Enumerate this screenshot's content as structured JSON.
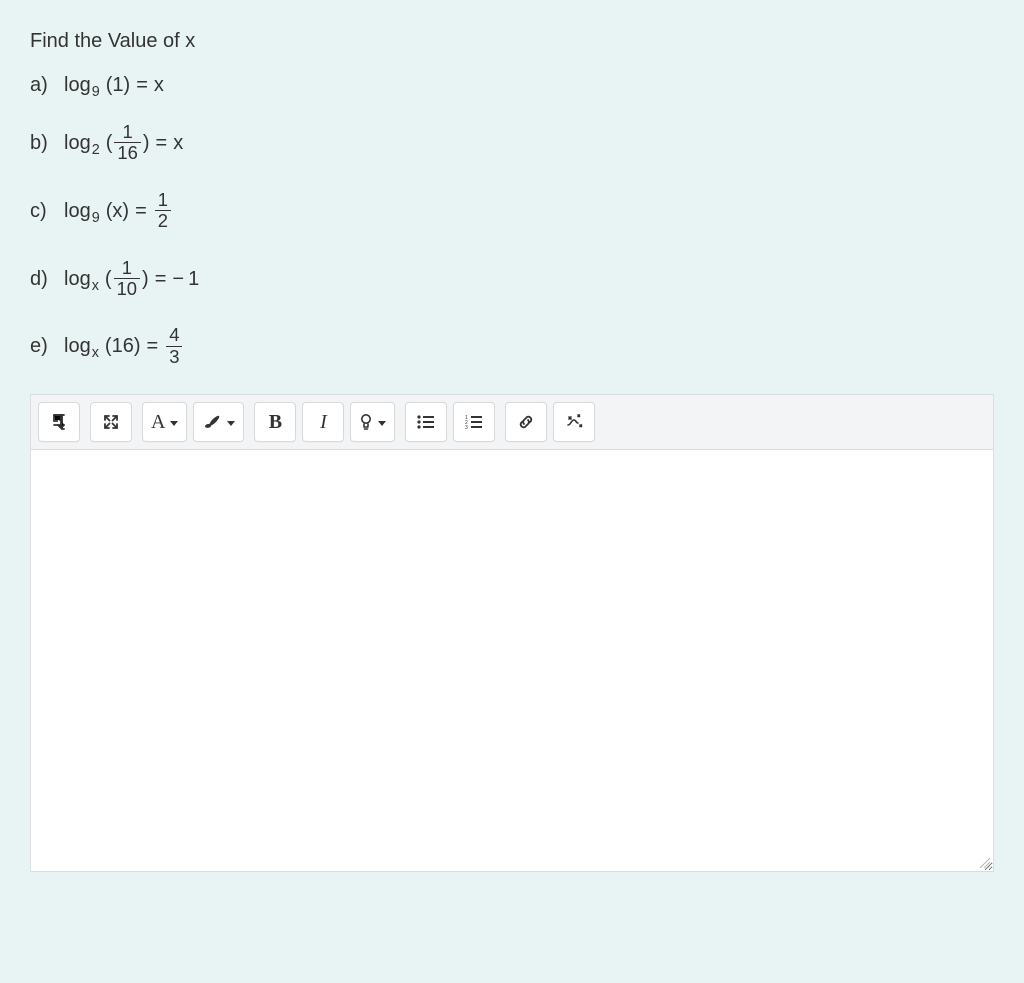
{
  "question": {
    "title": "Find the Value of x",
    "parts": [
      {
        "label": "a)",
        "log_word": "log",
        "base": "9",
        "argument": "1",
        "rhs": "x",
        "arg_is_fraction": false,
        "rhs_is_fraction": false,
        "rhs_negative": false
      },
      {
        "label": "b)",
        "log_word": "log",
        "base": "2",
        "arg_num": "1",
        "arg_den": "16",
        "rhs": "x",
        "arg_is_fraction": true,
        "rhs_is_fraction": false,
        "rhs_negative": false
      },
      {
        "label": "c)",
        "log_word": "log",
        "base": "9",
        "argument": "x",
        "rhs_num": "1",
        "rhs_den": "2",
        "arg_is_fraction": false,
        "rhs_is_fraction": true,
        "rhs_negative": false
      },
      {
        "label": "d)",
        "log_word": "log",
        "base": "x",
        "arg_num": "1",
        "arg_den": "10",
        "rhs": "1",
        "arg_is_fraction": true,
        "rhs_is_fraction": false,
        "rhs_negative": true
      },
      {
        "label": "e)",
        "log_word": "log",
        "base": "x",
        "argument": "16",
        "rhs_num": "4",
        "rhs_den": "3",
        "arg_is_fraction": false,
        "rhs_is_fraction": true,
        "rhs_negative": false
      }
    ]
  },
  "toolbar": {
    "paragraph_label": "¶",
    "font_family_label": "A",
    "bold_label": "B",
    "italic_label": "I"
  },
  "editor": {
    "placeholder": ""
  },
  "math": {
    "equals": "=",
    "minus": "−",
    "lparen": "(",
    "rparen": ")"
  }
}
